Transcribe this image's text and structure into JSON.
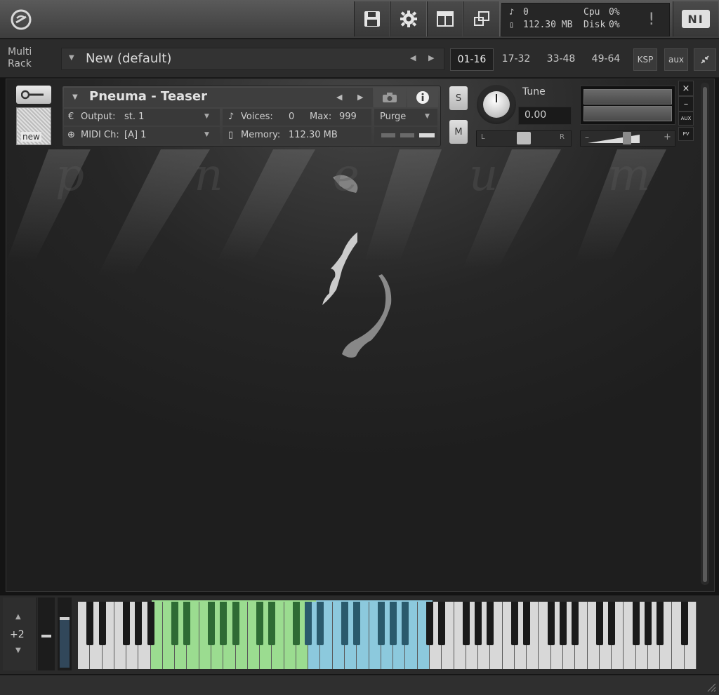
{
  "toolbar": {
    "stats": {
      "voices": "0",
      "memory": "112.30 MB",
      "cpu_label": "Cpu",
      "cpu_value": "0%",
      "disk_label": "Disk",
      "disk_value": "0%"
    },
    "warning_label": "!",
    "ni_logo_text": "NI"
  },
  "rack": {
    "label_line1": "Multi",
    "label_line2": "Rack",
    "multi_name": "New (default)",
    "pages": [
      "01-16",
      "17-32",
      "33-48",
      "49-64"
    ],
    "active_page": "01-16",
    "ksp_label": "KSP",
    "aux_label": "aux"
  },
  "instrument": {
    "name": "Pneuma - Teaser",
    "output_label": "Output:",
    "output_value": "st. 1",
    "midi_label": "MIDI Ch:",
    "midi_value": "[A]  1",
    "voices_label": "Voices:",
    "voices_value": "0",
    "max_label": "Max:",
    "max_value": "999",
    "memory_label": "Memory:",
    "memory_value": "112.30 MB",
    "purge_label": "Purge",
    "solo_label": "S",
    "mute_label": "M",
    "tune_label": "Tune",
    "tune_value": "0.00",
    "pan_left": "L",
    "pan_right": "R",
    "vol_minus": "–",
    "vol_plus": "+",
    "close_label": "×",
    "minimize_label": "–",
    "aux_label": "AUX",
    "pv_label": "PV",
    "thumb_label": "new"
  },
  "background_title": "p n e u m a",
  "keyboard": {
    "octave_value": "+2",
    "green_range_label": "",
    "colors": {
      "green": "#9bdc90",
      "green_dark": "#2e6b34",
      "blue": "#8cc9dd",
      "blue_dark": "#2a5a6c",
      "white": "#d8d8d8",
      "black": "#1a1a1a"
    }
  },
  "colors": {
    "accent": "#e8e8e8",
    "panel": "#3c3c3c",
    "bg": "#1f1f1f"
  }
}
